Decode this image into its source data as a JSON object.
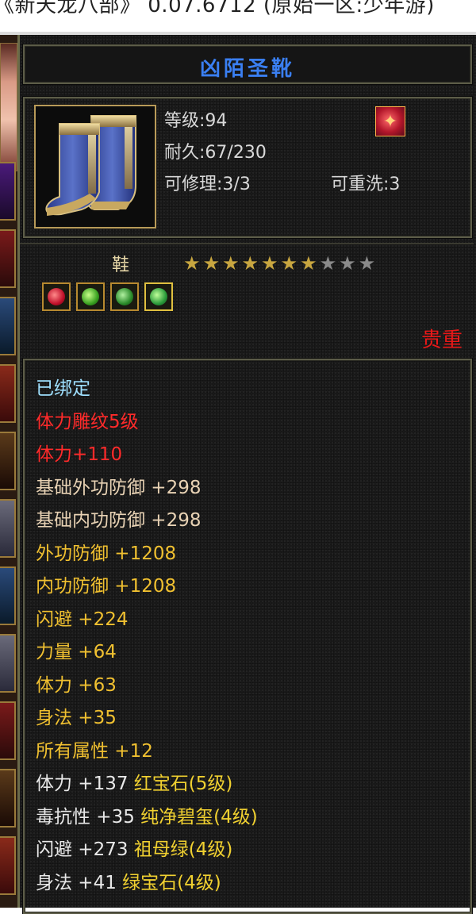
{
  "window": {
    "title": "《新天龙八部》 0.07.6712 (原始一区:少年游)"
  },
  "item": {
    "name": "凶陌圣靴",
    "level_text": "等级:94",
    "durability_text": "耐久:67/230",
    "repair_text": "可修理:3/3",
    "reroll_text": "可重洗:3",
    "badge_glyph": "✦",
    "slot_label": "鞋",
    "stars_total": 10,
    "stars_filled": 7,
    "rarity": "贵重",
    "gems": [
      "red",
      "green",
      "emerald",
      "yellow"
    ]
  },
  "stats": [
    {
      "text": "已绑定",
      "color": "cyan"
    },
    {
      "text": "体力雕纹5级",
      "color": "red"
    },
    {
      "text": "体力+110",
      "color": "red"
    },
    {
      "text": "基础外功防御 +298",
      "color": "beige"
    },
    {
      "text": "基础内功防御 +298",
      "color": "beige"
    },
    {
      "text": "外功防御 +1208",
      "color": "gold"
    },
    {
      "text": "内功防御 +1208",
      "color": "gold"
    },
    {
      "text": "闪避 +224",
      "color": "gold"
    },
    {
      "text": "力量 +64",
      "color": "gold"
    },
    {
      "text": "体力 +63",
      "color": "gold"
    },
    {
      "text": "身法 +35",
      "color": "gold"
    },
    {
      "text": "所有属性 +12",
      "color": "gold"
    },
    {
      "text": "体力 +137 ",
      "color": "white",
      "gem": "红宝石(5级)"
    },
    {
      "text": "毒抗性 +35 ",
      "color": "white",
      "gem": "纯净碧玺(4级)"
    },
    {
      "text": "闪避 +273 ",
      "color": "white",
      "gem": "祖母绿(4级)"
    },
    {
      "text": "身法 +41 ",
      "color": "white",
      "gem": "绿宝石(4级)"
    }
  ],
  "colors": {
    "name": "#3a7ff2",
    "rarity": "#e81818",
    "cyan": "#9fe0ff",
    "red": "#ff2a2a",
    "beige": "#e8d2b4",
    "gold": "#f0c030",
    "white": "#e8e8e8",
    "gem_text": "#f0d030"
  }
}
